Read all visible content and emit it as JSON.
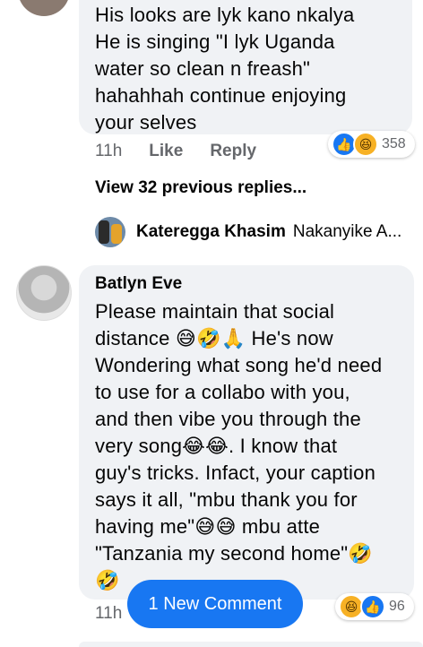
{
  "comment1": {
    "text": "His looks are lyk kano nkalya\nHe is singing \"I lyk Uganda\nwater so clean n freash\"\nhahahhah continue enjoying\nyour selves",
    "time": "11h",
    "like": "Like",
    "reply": "Reply",
    "reactions": {
      "icons": [
        "like-icon",
        "haha-icon"
      ],
      "count": "358"
    }
  },
  "view_previous": "View 32 previous replies...",
  "reply_preview": {
    "name": "Kateregga Khasim",
    "text": "Nakanyike A..."
  },
  "comment2": {
    "name": "Batlyn Eve",
    "text": "Please maintain that social\ndistance 😅🤣🙏 He's now\nWondering what song he'd need\nto use for a collabo with you,\nand then vibe you through the\nvery song😂😂. I know that\nguy's tricks. Infact, your caption\nsays it all, \"mbu thank you for\nhaving me\"😅😅 mbu atte\n\"Tanzania my second home\"🤣\n🤣",
    "time": "11h",
    "reactions": {
      "icons": [
        "haha-icon",
        "like-icon"
      ],
      "count": "96"
    }
  },
  "new_comment_button": "1 New Comment"
}
